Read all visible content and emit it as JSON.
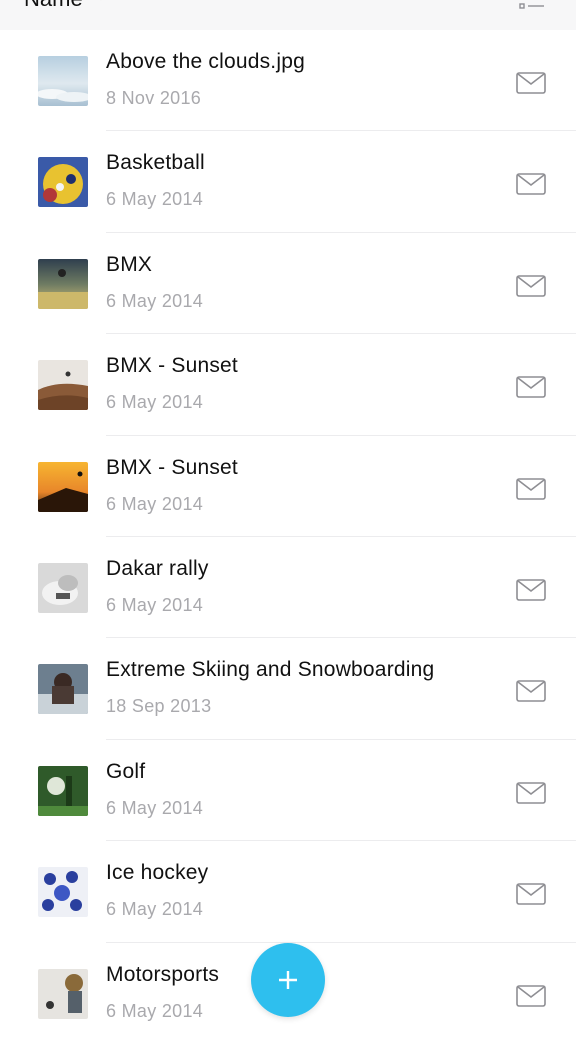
{
  "header": {
    "sort_label": "Name",
    "sort_icon": "chevron-down-icon",
    "view_icon": "list-view-icon"
  },
  "files": [
    {
      "name": "Above the clouds.jpg",
      "date": "8 Nov 2016",
      "thumb": "clouds"
    },
    {
      "name": "Basketball",
      "date": "6 May 2014",
      "thumb": "basketball"
    },
    {
      "name": "BMX",
      "date": "6 May 2014",
      "thumb": "bmx"
    },
    {
      "name": "BMX - Sunset",
      "date": "6 May 2014",
      "thumb": "bmx-sunset-desert"
    },
    {
      "name": "BMX - Sunset",
      "date": "6 May 2014",
      "thumb": "bmx-sunset-orange"
    },
    {
      "name": "Dakar rally",
      "date": "6 May 2014",
      "thumb": "dakar"
    },
    {
      "name": "Extreme Skiing and Snowboarding",
      "date": "18 Sep 2013",
      "thumb": "skiing"
    },
    {
      "name": "Golf",
      "date": "6 May 2014",
      "thumb": "golf"
    },
    {
      "name": "Ice hockey",
      "date": "6 May 2014",
      "thumb": "hockey"
    },
    {
      "name": "Motorsports",
      "date": "6 May 2014",
      "thumb": "motorsports"
    }
  ],
  "row_action_icon": "envelope-icon",
  "fab": {
    "icon": "plus-icon",
    "color": "#2ebfee"
  },
  "colors": {
    "title": "#111111",
    "date": "#a9a9ad",
    "header_bg": "#f7f7f8",
    "icon": "#8e8e93"
  }
}
